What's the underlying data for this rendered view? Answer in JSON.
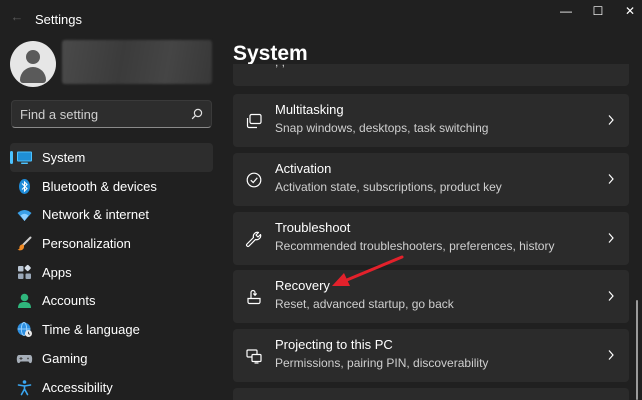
{
  "window": {
    "title": "Settings",
    "controls": {
      "minimize": "—",
      "maximize": "☐",
      "close": "✕"
    }
  },
  "search": {
    "placeholder": "Find a setting"
  },
  "sidebar": {
    "items": [
      {
        "label": "System",
        "icon": "monitor-icon",
        "active": true
      },
      {
        "label": "Bluetooth & devices",
        "icon": "bluetooth-icon"
      },
      {
        "label": "Network & internet",
        "icon": "wifi-icon"
      },
      {
        "label": "Personalization",
        "icon": "brush-icon"
      },
      {
        "label": "Apps",
        "icon": "apps-icon"
      },
      {
        "label": "Accounts",
        "icon": "accounts-icon"
      },
      {
        "label": "Time & language",
        "icon": "globe-clock-icon"
      },
      {
        "label": "Gaming",
        "icon": "gamepad-icon"
      },
      {
        "label": "Accessibility",
        "icon": "accessibility-icon"
      }
    ]
  },
  "main": {
    "title": "System",
    "cards": [
      {
        "title": "Multitasking",
        "desc": "Snap windows, desktops, task switching",
        "icon": "multitasking-icon"
      },
      {
        "title": "Activation",
        "desc": "Activation state, subscriptions, product key",
        "icon": "check-circle-icon"
      },
      {
        "title": "Troubleshoot",
        "desc": "Recommended troubleshooters, preferences, history",
        "icon": "wrench-icon"
      },
      {
        "title": "Recovery",
        "desc": "Reset, advanced startup, go back",
        "icon": "recovery-icon"
      },
      {
        "title": "Projecting to this PC",
        "desc": "Permissions, pairing PIN, discoverability",
        "icon": "projecting-icon"
      }
    ]
  },
  "colors": {
    "background": "#202020",
    "card": "#2b2b2b",
    "accent": "#4cc2ff",
    "annotation_arrow": "#e3212b"
  }
}
